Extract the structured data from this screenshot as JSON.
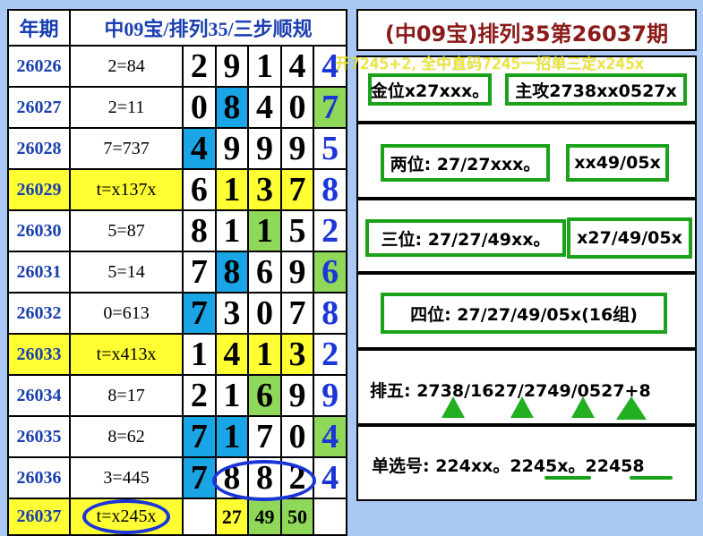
{
  "header": {
    "col_period": "年期",
    "col_title": "中09宝/排列35/三步顺规",
    "right_title": "(中09宝)排列35第26037期"
  },
  "rows": [
    {
      "period": "26026",
      "hint": "2=84",
      "d": [
        "2",
        "9",
        "1",
        "4"
      ],
      "last": "4",
      "hl": [
        0,
        0,
        0,
        0
      ],
      "hlast": 0,
      "y": false
    },
    {
      "period": "26027",
      "hint": "2=11",
      "d": [
        "0",
        "8",
        "4",
        "0"
      ],
      "last": "7",
      "hl": [
        0,
        2,
        0,
        0
      ],
      "hlast": 1,
      "y": false
    },
    {
      "period": "26028",
      "hint": "7=737",
      "d": [
        "4",
        "9",
        "9",
        "9"
      ],
      "last": "5",
      "hl": [
        2,
        0,
        0,
        0
      ],
      "hlast": 0,
      "y": false
    },
    {
      "period": "26029",
      "hint": "t=x137x",
      "d": [
        "6",
        "1",
        "3",
        "7"
      ],
      "last": "8",
      "hl": [
        0,
        1,
        1,
        1
      ],
      "hlast": 0,
      "y": true
    },
    {
      "period": "26030",
      "hint": "5=87",
      "d": [
        "8",
        "1",
        "1",
        "5"
      ],
      "last": "2",
      "hl": [
        0,
        0,
        3,
        0
      ],
      "hlast": 0,
      "y": false
    },
    {
      "period": "26031",
      "hint": "5=14",
      "d": [
        "7",
        "8",
        "6",
        "9"
      ],
      "last": "6",
      "hl": [
        0,
        2,
        0,
        0
      ],
      "hlast": 1,
      "y": false
    },
    {
      "period": "26032",
      "hint": "0=613",
      "d": [
        "7",
        "3",
        "0",
        "7"
      ],
      "last": "8",
      "hl": [
        2,
        0,
        0,
        0
      ],
      "hlast": 0,
      "y": false
    },
    {
      "period": "26033",
      "hint": "t=x413x",
      "d": [
        "1",
        "4",
        "1",
        "3"
      ],
      "last": "2",
      "hl": [
        0,
        1,
        1,
        1
      ],
      "hlast": 0,
      "y": true
    },
    {
      "period": "26034",
      "hint": "8=17",
      "d": [
        "2",
        "1",
        "6",
        "9"
      ],
      "last": "9",
      "hl": [
        0,
        0,
        3,
        0
      ],
      "hlast": 0,
      "y": false
    },
    {
      "period": "26035",
      "hint": "8=62",
      "d": [
        "7",
        "1",
        "7",
        "0"
      ],
      "last": "4",
      "hl": [
        2,
        2,
        0,
        0
      ],
      "hlast": 1,
      "y": false
    },
    {
      "period": "26036",
      "hint": "3=445",
      "d": [
        "7",
        "8",
        "8",
        "2"
      ],
      "last": "4",
      "hl": [
        2,
        0,
        0,
        0
      ],
      "hlast": 0,
      "y": false
    }
  ],
  "pred_row": {
    "period": "26037",
    "hint": "t=x245x",
    "nums": [
      "27",
      "49",
      "50"
    ]
  },
  "right": {
    "overlay": "开7245+2, 全中直码7245一招单三定x245x",
    "b1_left": "金位x27xxx。",
    "b1_right": "主攻2738xx0527x",
    "b2_left": "两位: 27/27xxx。",
    "b2_right": "xx49/05x",
    "b3_left": "三位: 27/27/49xx。",
    "b3_right": "x27/49/05x",
    "b4": "四位: 27/27/49/05x(16组)",
    "b5": "排五: 2738/1627/2749/0527+8",
    "b6": "单选号: 224xx。2245x。22458"
  },
  "colors": {
    "period_blue": "#1b3fb0",
    "yellow": "#ffff33",
    "cyan": "#1aa6e6",
    "green": "#8fd85a",
    "box_green": "#1aa31a",
    "title_brown": "#8b1a1a"
  }
}
